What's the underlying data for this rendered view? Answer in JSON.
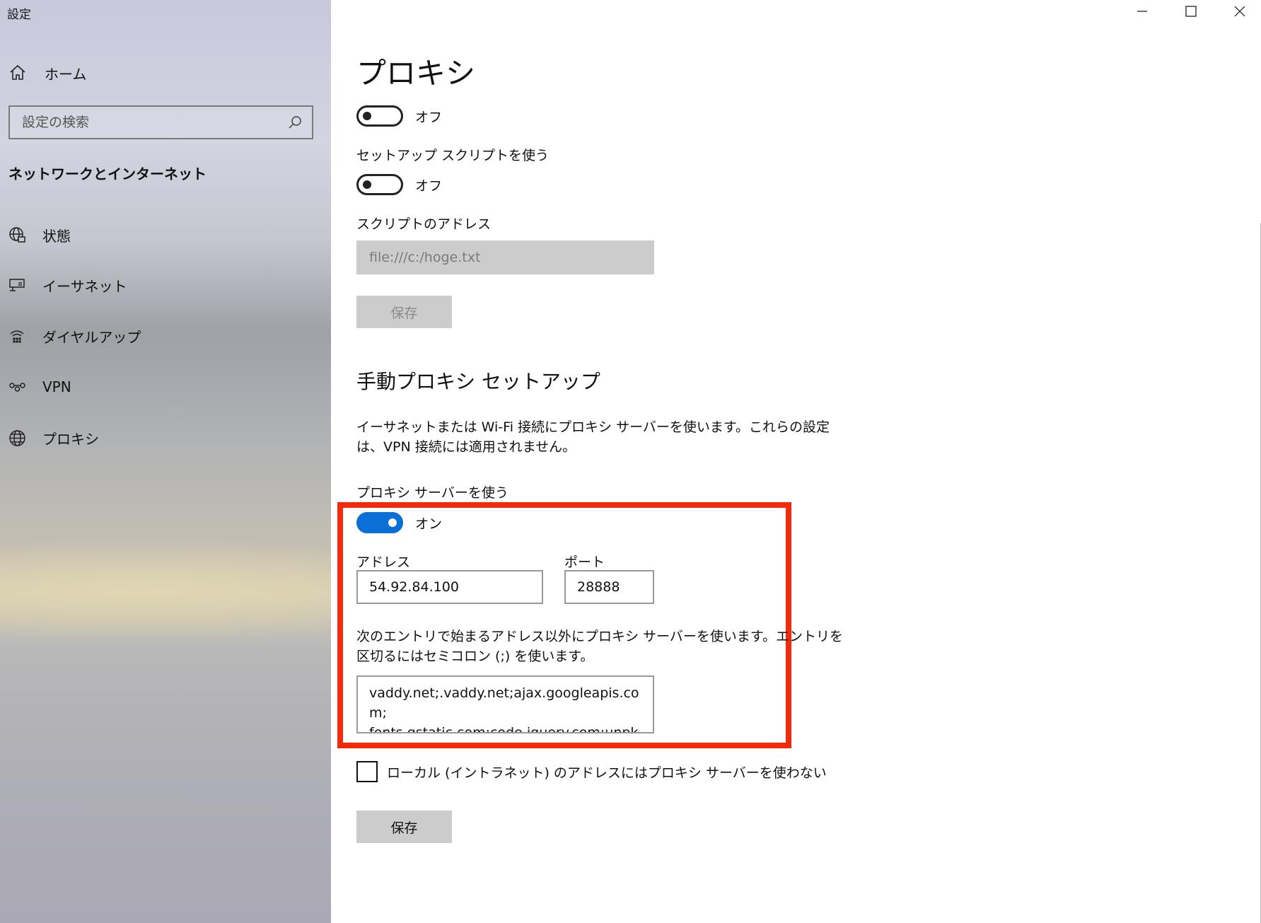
{
  "window": {
    "title": "設定",
    "minimize_icon": "minimize-icon",
    "maximize_icon": "maximize-icon",
    "close_icon": "close-icon"
  },
  "sidebar": {
    "home": {
      "label": "ホーム",
      "icon": "home-icon"
    },
    "search": {
      "placeholder": "設定の検索",
      "icon": "search-icon"
    },
    "section_title": "ネットワークとインターネット",
    "items": [
      {
        "label": "状態",
        "icon": "network-status-icon"
      },
      {
        "label": "イーサネット",
        "icon": "ethernet-icon"
      },
      {
        "label": "ダイヤルアップ",
        "icon": "dialup-icon"
      },
      {
        "label": "VPN",
        "icon": "vpn-icon"
      },
      {
        "label": "プロキシ",
        "icon": "globe-icon"
      }
    ]
  },
  "main": {
    "page_title": "プロキシ",
    "auto_detect": {
      "state": "オフ",
      "on": false
    },
    "setup_script": {
      "label": "セットアップ スクリプトを使う",
      "state": "オフ",
      "on": false,
      "address_label": "スクリプトのアドレス",
      "address_value": "file:///c:/hoge.txt",
      "save_label": "保存"
    },
    "manual": {
      "heading": "手動プロキシ セットアップ",
      "description": "イーサネットまたは Wi-Fi 接続にプロキシ サーバーを使います。これらの設定は、VPN 接続には適用されません。",
      "use_proxy_label": "プロキシ サーバーを使う",
      "use_proxy_state": "オン",
      "use_proxy_on": true,
      "address_label": "アドレス",
      "address_value": "54.92.84.100",
      "port_label": "ポート",
      "port_value": "28888",
      "exceptions_description": "次のエントリで始まるアドレス以外にプロキシ サーバーを使います。エントリを区切るにはセミコロン (;) を使います。",
      "exceptions_value": "vaddy.net;.vaddy.net;ajax.googleapis.com;\nfonts.gstatic.com;code.jquery.com;unpkg.",
      "bypass_local_label": "ローカル (イントラネット) のアドレスにはプロキシ サーバーを使わない",
      "bypass_local_checked": false,
      "save_label": "保存"
    },
    "accent_color": "#0a6fd6",
    "highlight_color": "#f52a0a"
  }
}
